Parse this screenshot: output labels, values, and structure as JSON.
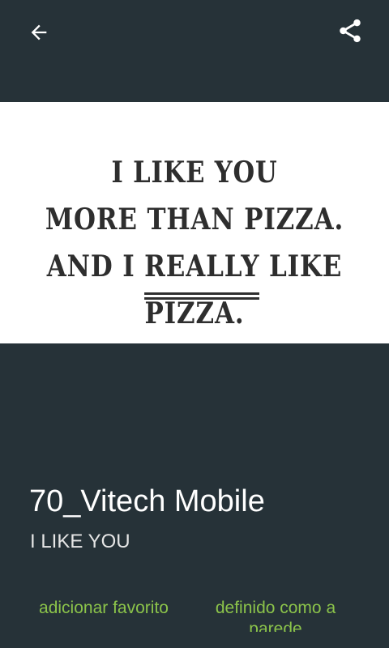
{
  "toolbar": {
    "back_icon": "arrow-left-icon",
    "share_icon": "share-icon",
    "background_color": "#263238"
  },
  "image": {
    "quote_line_1": "I LIKE YOU",
    "quote_line_2": "MORE THAN PIZZA.",
    "quote_line_3_before": "AND I ",
    "quote_line_3_underlined": "REALLY",
    "quote_line_3_after": " LIKE",
    "quote_line_4": "PIZZA."
  },
  "info": {
    "title": "70_Vitech Mobile",
    "subtitle": "I LIKE YOU"
  },
  "actions": {
    "favorite_label": "adicionar favorito",
    "wallpaper_label": "definido como a parede",
    "accent_color": "#8bc34a"
  }
}
